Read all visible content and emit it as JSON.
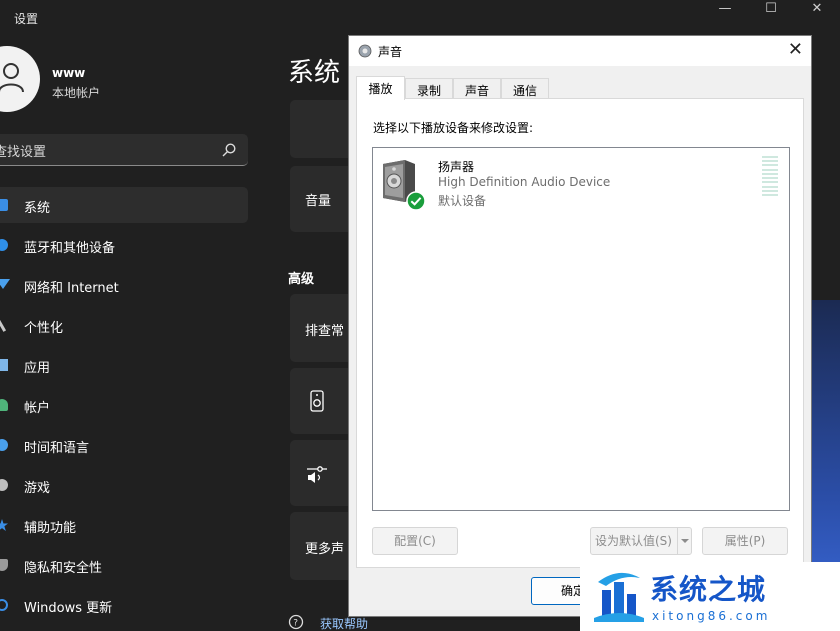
{
  "settings": {
    "title": "设置",
    "window_controls": [
      "—",
      "☐",
      "✕"
    ],
    "user": {
      "name": "www",
      "account_type": "本地帐户"
    },
    "search": {
      "text": "查找设置"
    },
    "nav": [
      {
        "label": "系统",
        "icon": "monitor-icon",
        "active": true,
        "color": "#3a8ee6"
      },
      {
        "label": "蓝牙和其他设备",
        "icon": "bluetooth-icon",
        "active": false,
        "color": "#2f8fe8"
      },
      {
        "label": "网络和 Internet",
        "icon": "wifi-icon",
        "active": false,
        "color": "#4aa0ec"
      },
      {
        "label": "个性化",
        "icon": "brush-icon",
        "active": false,
        "color": "#c9c9c9"
      },
      {
        "label": "应用",
        "icon": "apps-icon",
        "active": false,
        "color": "#7fb6e8"
      },
      {
        "label": "帐户",
        "icon": "person-icon",
        "active": false,
        "color": "#4fb37a"
      },
      {
        "label": "时间和语言",
        "icon": "globe-clock-icon",
        "active": false,
        "color": "#4aa0ec"
      },
      {
        "label": "游戏",
        "icon": "gamepad-icon",
        "active": false,
        "color": "#bdbdbd"
      },
      {
        "label": "辅助功能",
        "icon": "accessibility-icon",
        "active": false,
        "color": "#3a8ee6"
      },
      {
        "label": "隐私和安全性",
        "icon": "shield-icon",
        "active": false,
        "color": "#9a9a9a"
      },
      {
        "label": "Windows 更新",
        "icon": "update-icon",
        "active": false,
        "color": "#3a8ee6"
      }
    ],
    "page_title": "系统",
    "cards": {
      "volume": "音量",
      "troubleshoot": "排查常",
      "more_sound": "更多声"
    },
    "section_advanced": "高级",
    "help_link": "获取帮助"
  },
  "dialog": {
    "title": "声音",
    "tabs": [
      "播放",
      "录制",
      "声音",
      "通信"
    ],
    "instruction": "选择以下播放设备来修改设置:",
    "device": {
      "name": "扬声器",
      "description": "High Definition Audio Device",
      "status": "默认设备"
    },
    "buttons": {
      "configure": "配置(C)",
      "set_default": "设为默认值(S)",
      "properties": "属性(P)",
      "ok": "确定"
    }
  },
  "watermark": {
    "title": "系统之城",
    "url": "xitong86.com"
  }
}
